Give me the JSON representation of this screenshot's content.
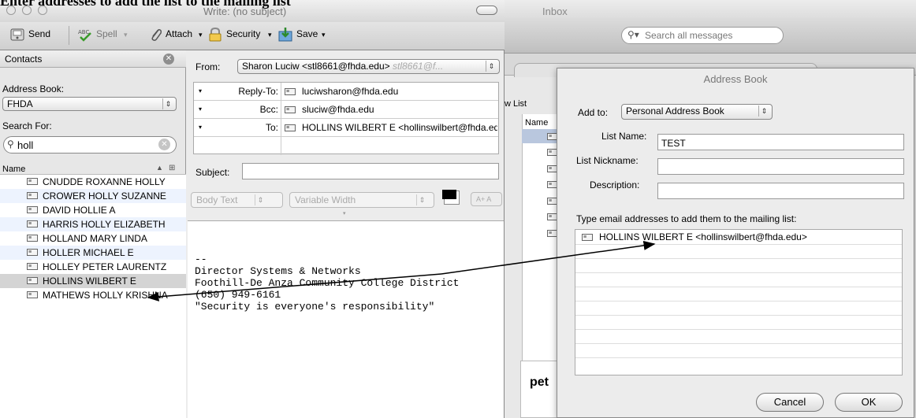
{
  "doc_heading": "Enter addresses to add the list to the mailing list",
  "inbox": {
    "title": "Inbox",
    "search_placeholder": "Search all messages",
    "list_label": "w List",
    "col_name": "Name",
    "preview_text": "pet"
  },
  "compose": {
    "title": "Write: (no subject)",
    "toolbar": {
      "send": "Send",
      "spell": "Spell",
      "attach": "Attach",
      "security": "Security",
      "save": "Save"
    },
    "from_label": "From:",
    "from_value": "Sharon Luciw <stl8661@fhda.edu>",
    "from_hint": "stl8661@f...",
    "recipients": [
      {
        "type": "Reply-To:",
        "value": "luciwsharon@fhda.edu"
      },
      {
        "type": "Bcc:",
        "value": "sluciw@fhda.edu"
      },
      {
        "type": "To:",
        "value": "HOLLINS WILBERT E <hollinswilbert@fhda.edu>"
      }
    ],
    "subject_label": "Subject:",
    "subject_value": "",
    "format": {
      "style": "Body Text",
      "font": "Variable Width",
      "size_btn": "A+ A"
    },
    "signature": "--\nDirector Systems & Networks\nFoothill-De Anza Community College District\n(650) 949-6161\n\"Security is everyone's responsibility\""
  },
  "contacts": {
    "title": "Contacts",
    "address_book_label": "Address Book:",
    "address_book_value": "FHDA",
    "search_label": "Search For:",
    "search_value": "holl",
    "col_name": "Name",
    "items": [
      "CNUDDE ROXANNE HOLLY",
      "CROWER HOLLY SUZANNE",
      "DAVID HOLLIE A",
      "HARRIS HOLLY ELIZABETH",
      "HOLLAND MARY LINDA",
      "HOLLER MICHAEL E",
      "HOLLEY PETER LAURENTZ",
      "HOLLINS WILBERT E",
      "MATHEWS HOLLY KRISHNA"
    ],
    "selected_index": 7
  },
  "address_book": {
    "title": "Address Book",
    "add_to_label": "Add to:",
    "add_to_value": "Personal Address Book",
    "list_name_label": "List Name:",
    "list_name_value": "TEST",
    "nickname_label": "List Nickname:",
    "nickname_value": "",
    "description_label": "Description:",
    "description_value": "",
    "instructions": "Type email addresses to add them to the mailing list:",
    "members": [
      "HOLLINS WILBERT E <hollinswilbert@fhda.edu>"
    ],
    "cancel_label": "Cancel",
    "ok_label": "OK"
  },
  "colors": {
    "selection_grey": "#d4d4d4",
    "alt_row_blue": "#edf3fe",
    "window_bg": "#ececec"
  }
}
